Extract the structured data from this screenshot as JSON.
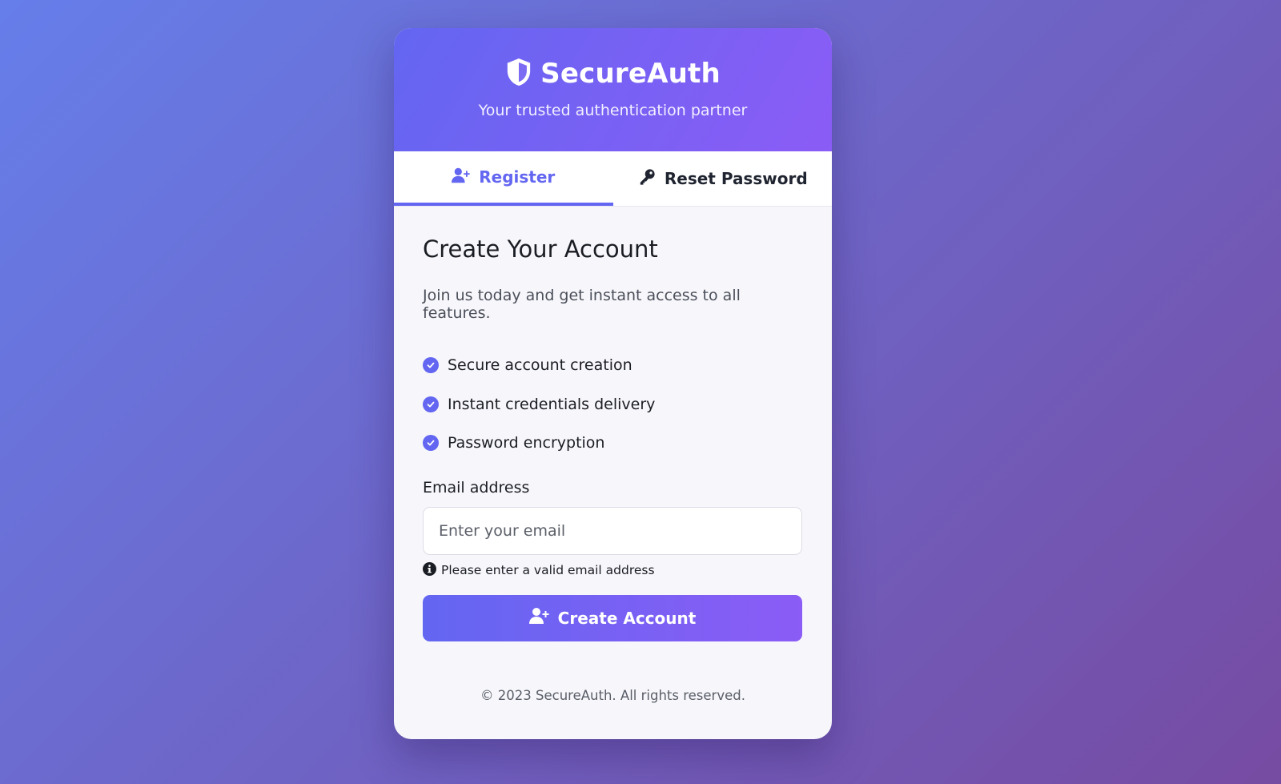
{
  "brand": {
    "name": "SecureAuth",
    "tagline": "Your trusted authentication partner"
  },
  "tabs": [
    {
      "label": "Register",
      "icon": "user-plus-icon",
      "active": true
    },
    {
      "label": "Reset Password",
      "icon": "key-icon",
      "active": false
    }
  ],
  "register": {
    "title": "Create Your Account",
    "description": "Join us today and get instant access to all features.",
    "features": [
      "Secure account creation",
      "Instant credentials delivery",
      "Password encryption"
    ],
    "email_label": "Email address",
    "email_placeholder": "Enter your email",
    "email_value": "",
    "hint": "Please enter a valid email address",
    "submit_label": "Create Account"
  },
  "footer": {
    "text": "© 2023 SecureAuth. All rights reserved."
  },
  "colors": {
    "accent": "#6366f1",
    "accent_end": "#8b5cf6",
    "background_start": "#667eea",
    "background_end": "#764ba2"
  }
}
